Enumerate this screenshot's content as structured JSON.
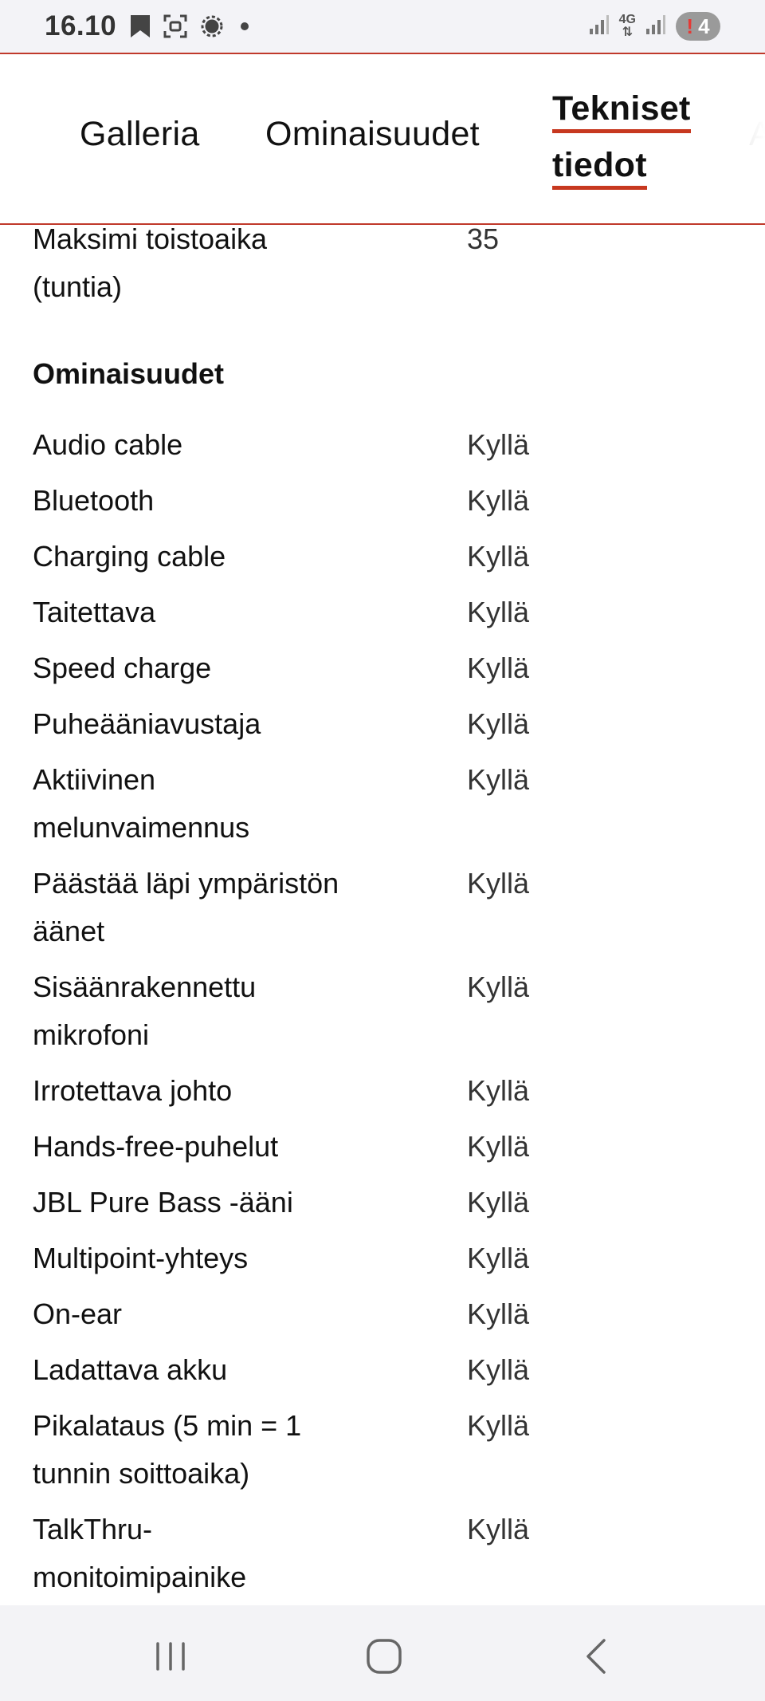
{
  "status_bar": {
    "time": "16.10",
    "network_label_top": "4G",
    "notification_count": "4",
    "notification_alert": "!"
  },
  "tabs": {
    "gallery": "Galleria",
    "features": "Ominaisuudet",
    "specs_line1": "Tekniset",
    "specs_line2": "tiedot",
    "next_partial": "A"
  },
  "specs": {
    "top_row": {
      "label_line1": "Maksimi toistoaika",
      "label_line2": "(tuntia)",
      "value": "35"
    },
    "section_title": "Ominaisuudet",
    "rows": [
      {
        "label": "Audio cable",
        "value": "Kyllä"
      },
      {
        "label": "Bluetooth",
        "value": "Kyllä"
      },
      {
        "label": "Charging cable",
        "value": "Kyllä"
      },
      {
        "label": "Taitettava",
        "value": "Kyllä"
      },
      {
        "label": "Speed charge",
        "value": "Kyllä"
      },
      {
        "label": "Puheääniavustaja",
        "value": "Kyllä"
      },
      {
        "label": "Aktiivinen melunvaimennus",
        "label_line1": "Aktiivinen",
        "label_line2": "melunvaimennus",
        "value": "Kyllä"
      },
      {
        "label": "Päästää läpi ympäristön äänet",
        "label_line1": "Päästää läpi ympäristön",
        "label_line2": "äänet",
        "value": "Kyllä"
      },
      {
        "label": "Sisäänrakennettu mikrofoni",
        "label_line1": "Sisäänrakennettu",
        "label_line2": "mikrofoni",
        "value": "Kyllä"
      },
      {
        "label": "Irrotettava johto",
        "value": "Kyllä"
      },
      {
        "label": "Hands-free-puhelut",
        "value": "Kyllä"
      },
      {
        "label": "JBL Pure Bass -ääni",
        "value": "Kyllä"
      },
      {
        "label": "Multipoint-yhteys",
        "value": "Kyllä"
      },
      {
        "label": "On-ear",
        "value": "Kyllä"
      },
      {
        "label": "Ladattava akku",
        "value": "Kyllä"
      },
      {
        "label": "Pikalataus (5 min = 1 tunnin soittoaika)",
        "label_line1": "Pikalataus (5 min = 1",
        "label_line2": "tunnin soittoaika)",
        "value": "Kyllä"
      },
      {
        "label": "TalkThru-monitoimipainike",
        "label_line1": "TalkThru-",
        "label_line2": "monitoimipainike",
        "value": "Kyllä"
      }
    ]
  },
  "nav_bar": {
    "buttons": [
      "recents-icon",
      "home-icon",
      "back-icon"
    ]
  },
  "colors": {
    "accent": "#c7381f",
    "header_border": "#c0392b",
    "text": "#111111",
    "value_text": "#333333",
    "status_bg": "#f3f3f7",
    "nav_bg": "#f3f3f6"
  }
}
